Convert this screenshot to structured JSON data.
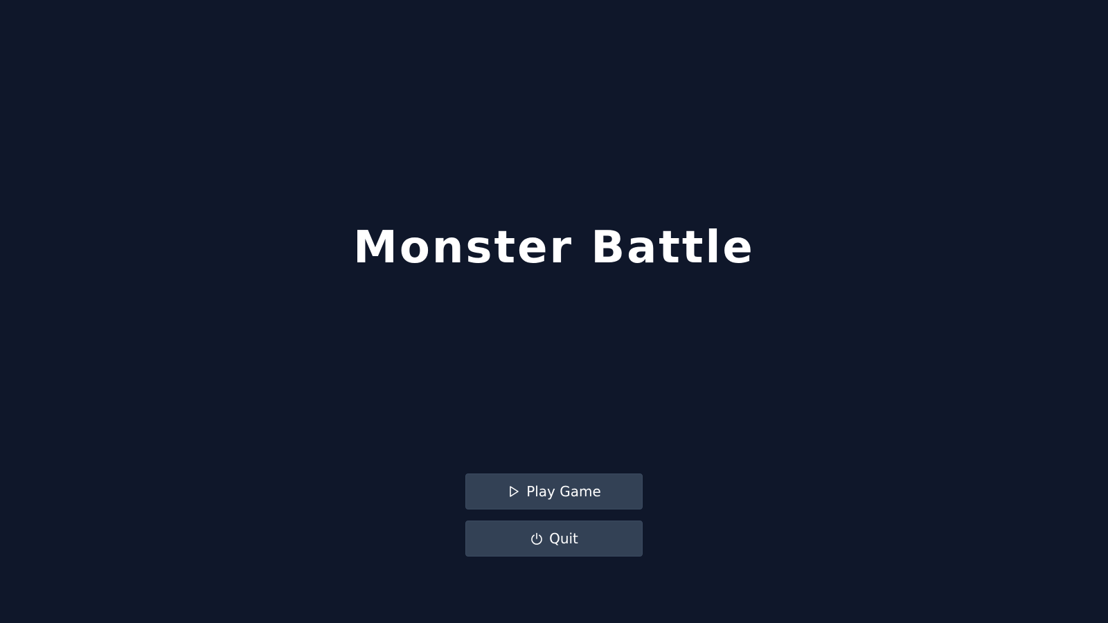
{
  "game": {
    "title": "Monster Battle"
  },
  "menu": {
    "play": {
      "label": "Play Game",
      "icon": "play-icon"
    },
    "quit": {
      "label": "Quit",
      "icon": "power-icon"
    }
  },
  "colors": {
    "background": "#0f172a",
    "button": "#334155",
    "text": "#ffffff"
  }
}
